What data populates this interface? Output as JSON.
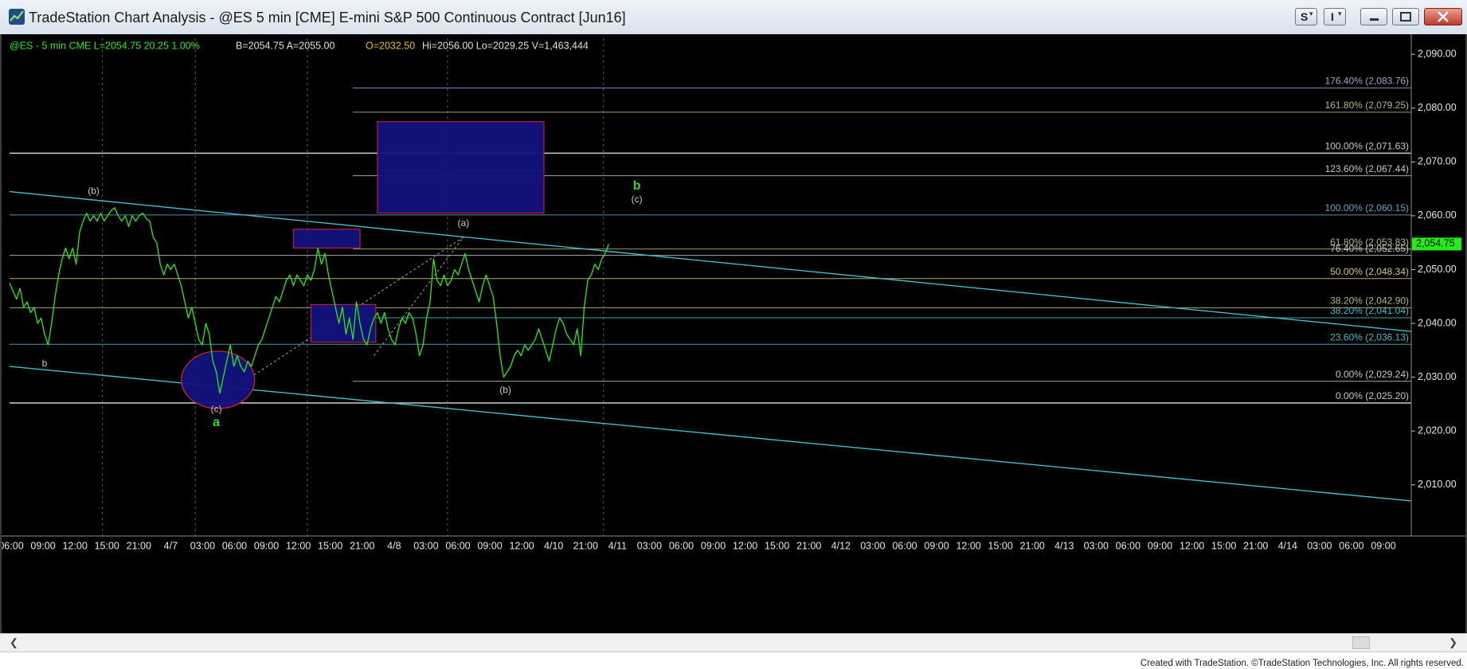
{
  "window": {
    "title": "TradeStation Chart Analysis - @ES 5 min [CME] E-mini S&P 500 Continuous Contract [Jun16]",
    "s_button_label": "S",
    "i_button_label": "I"
  },
  "header": {
    "symbol_line": "@ES - 5 min  CME  L=2054.75  20.25  1.00%",
    "bid_ask": "B=2054.75  A=2055.00",
    "open": "O=2032.50",
    "high_low_volume": "Hi=2056.00  Lo=2029.25  V=1,463,444"
  },
  "colors": {
    "background": "#000000",
    "price": "#22ee11",
    "channel": "#3ec0c8",
    "box_fill": "#12127e",
    "box_border": "#c8223a",
    "wave_green": "#33dd22",
    "label_gray": "#c8c8d0",
    "last_price_bg": "#22ee11"
  },
  "footer": {
    "credit": "Created with TradeStation. ©TradeStation Technologies, Inc. All rights reserved."
  },
  "chart_data": {
    "type": "line",
    "title": "",
    "xlabel": "",
    "ylabel": "",
    "ylim": [
      2003,
      2093
    ],
    "last_price": "2,054.75",
    "y_ticks": [
      2010,
      2020,
      2030,
      2040,
      2050,
      2060,
      2070,
      2080,
      2090
    ],
    "y_tick_labels": [
      "2,010.00",
      "2,020.00",
      "2,030.00",
      "2,040.00",
      "2,050.00",
      "2,060.00",
      "2,070.00",
      "2,080.00",
      "2,090.00"
    ],
    "x_tick_labels": [
      "06:00",
      "09:00",
      "12:00",
      "15:00",
      "21:00",
      "4/7",
      "03:00",
      "06:00",
      "09:00",
      "12:00",
      "15:00",
      "21:00",
      "4/8",
      "03:00",
      "06:00",
      "09:00",
      "12:00",
      "4/10",
      "21:00",
      "4/11",
      "03:00",
      "06:00",
      "09:00",
      "12:00",
      "15:00",
      "21:00",
      "4/12",
      "03:00",
      "06:00",
      "09:00",
      "12:00",
      "15:00",
      "21:00",
      "4/13",
      "03:00",
      "06:00",
      "09:00",
      "12:00",
      "15:00",
      "21:00",
      "4/14",
      "03:00",
      "06:00",
      "09:00"
    ],
    "series": [
      {
        "name": "@ES 5 min",
        "points": [
          [
            0,
            2047.5
          ],
          [
            2,
            2046
          ],
          [
            4,
            2044.5
          ],
          [
            6,
            2046.5
          ],
          [
            8,
            2043
          ],
          [
            10,
            2044
          ],
          [
            12,
            2042
          ],
          [
            14,
            2043
          ],
          [
            16,
            2040
          ],
          [
            18,
            2041
          ],
          [
            20,
            2038
          ],
          [
            22,
            2036
          ],
          [
            24,
            2040
          ],
          [
            26,
            2045
          ],
          [
            28,
            2049
          ],
          [
            30,
            2052
          ],
          [
            32,
            2054
          ],
          [
            34,
            2052
          ],
          [
            36,
            2054
          ],
          [
            38,
            2051
          ],
          [
            40,
            2057
          ],
          [
            42,
            2059
          ],
          [
            44,
            2060.5
          ],
          [
            46,
            2059
          ],
          [
            48,
            2060
          ],
          [
            50,
            2059
          ],
          [
            52,
            2060.5
          ],
          [
            54,
            2059
          ],
          [
            56,
            2060
          ],
          [
            58,
            2061
          ],
          [
            60,
            2061.5
          ],
          [
            62,
            2060
          ],
          [
            64,
            2059
          ],
          [
            66,
            2060
          ],
          [
            68,
            2058
          ],
          [
            70,
            2060
          ],
          [
            72,
            2059
          ],
          [
            74,
            2060
          ],
          [
            76,
            2060.5
          ],
          [
            78,
            2059.5
          ],
          [
            80,
            2059
          ],
          [
            82,
            2056
          ],
          [
            84,
            2055
          ],
          [
            86,
            2051
          ],
          [
            88,
            2049
          ],
          [
            90,
            2051
          ],
          [
            92,
            2050
          ],
          [
            94,
            2051
          ],
          [
            96,
            2049
          ],
          [
            98,
            2047
          ],
          [
            100,
            2044
          ],
          [
            102,
            2041
          ],
          [
            104,
            2043
          ],
          [
            106,
            2040
          ],
          [
            108,
            2037
          ],
          [
            110,
            2036
          ],
          [
            112,
            2040
          ],
          [
            114,
            2038
          ],
          [
            116,
            2033
          ],
          [
            118,
            2031
          ],
          [
            120,
            2027
          ],
          [
            122,
            2030
          ],
          [
            124,
            2033
          ],
          [
            126,
            2036
          ],
          [
            128,
            2032
          ],
          [
            130,
            2034
          ],
          [
            132,
            2032
          ],
          [
            134,
            2031
          ],
          [
            136,
            2033
          ],
          [
            138,
            2032
          ],
          [
            140,
            2034
          ],
          [
            142,
            2036
          ],
          [
            144,
            2037
          ],
          [
            146,
            2039
          ],
          [
            148,
            2041
          ],
          [
            150,
            2043
          ],
          [
            152,
            2045
          ],
          [
            154,
            2044
          ],
          [
            156,
            2046
          ],
          [
            158,
            2048
          ],
          [
            160,
            2049
          ],
          [
            162,
            2047
          ],
          [
            164,
            2049
          ],
          [
            166,
            2048
          ],
          [
            168,
            2047
          ],
          [
            170,
            2049
          ],
          [
            172,
            2048
          ],
          [
            174,
            2050
          ],
          [
            176,
            2054
          ],
          [
            178,
            2051
          ],
          [
            180,
            2053
          ],
          [
            182,
            2049
          ],
          [
            184,
            2046
          ],
          [
            186,
            2043
          ],
          [
            188,
            2040
          ],
          [
            190,
            2043
          ],
          [
            192,
            2038
          ],
          [
            194,
            2041
          ],
          [
            196,
            2037
          ],
          [
            198,
            2044
          ],
          [
            200,
            2040
          ],
          [
            202,
            2037
          ],
          [
            204,
            2036
          ],
          [
            206,
            2039
          ],
          [
            208,
            2041
          ],
          [
            210,
            2042
          ],
          [
            212,
            2040
          ],
          [
            214,
            2042
          ],
          [
            216,
            2039
          ],
          [
            218,
            2037
          ],
          [
            220,
            2036
          ],
          [
            222,
            2039
          ],
          [
            224,
            2041
          ],
          [
            226,
            2040
          ],
          [
            228,
            2042
          ],
          [
            230,
            2041
          ],
          [
            232,
            2038
          ],
          [
            234,
            2034
          ],
          [
            236,
            2036
          ],
          [
            238,
            2041
          ],
          [
            240,
            2044
          ],
          [
            242,
            2052
          ],
          [
            244,
            2048
          ],
          [
            246,
            2047
          ],
          [
            248,
            2049
          ],
          [
            250,
            2047
          ],
          [
            252,
            2048
          ],
          [
            254,
            2050
          ],
          [
            256,
            2049
          ],
          [
            258,
            2051
          ],
          [
            260,
            2053
          ],
          [
            262,
            2050
          ],
          [
            264,
            2048
          ],
          [
            266,
            2046
          ],
          [
            268,
            2044
          ],
          [
            270,
            2047
          ],
          [
            272,
            2049
          ],
          [
            274,
            2047
          ],
          [
            276,
            2045
          ],
          [
            278,
            2040
          ],
          [
            280,
            2034
          ],
          [
            282,
            2030
          ],
          [
            284,
            2031
          ],
          [
            286,
            2032
          ],
          [
            288,
            2034
          ],
          [
            290,
            2035
          ],
          [
            292,
            2034
          ],
          [
            294,
            2036
          ],
          [
            296,
            2035
          ],
          [
            298,
            2036
          ],
          [
            300,
            2037
          ],
          [
            302,
            2039
          ],
          [
            304,
            2037
          ],
          [
            306,
            2035
          ],
          [
            308,
            2033
          ],
          [
            310,
            2036
          ],
          [
            312,
            2039
          ],
          [
            314,
            2041
          ],
          [
            316,
            2040
          ],
          [
            318,
            2038
          ],
          [
            320,
            2037
          ],
          [
            322,
            2036
          ],
          [
            324,
            2039
          ],
          [
            326,
            2034
          ],
          [
            328,
            2043
          ],
          [
            330,
            2048
          ],
          [
            332,
            2049
          ],
          [
            334,
            2051
          ],
          [
            336,
            2050
          ],
          [
            338,
            2052
          ],
          [
            340,
            2053
          ],
          [
            342,
            2054.75
          ]
        ]
      }
    ],
    "channel_lines": [
      {
        "from": [
          0,
          2064.5
        ],
        "to": [
          800,
          2038.5
        ]
      },
      {
        "from": [
          0,
          2032
        ],
        "to": [
          800,
          2007
        ]
      }
    ],
    "boxes": [
      {
        "x0": 210,
        "x1": 305,
        "y0": 2060.5,
        "y1": 2077.5
      },
      {
        "x0": 162,
        "x1": 200,
        "y0": 2054,
        "y1": 2057.5
      },
      {
        "x0": 172,
        "x1": 209,
        "y0": 2036.5,
        "y1": 2043.5
      }
    ],
    "ellipse": {
      "cx": 119,
      "cy": 2029.5,
      "label": "(c)"
    },
    "dashed_lines": [
      {
        "from": [
          119,
          2026
        ],
        "to": [
          259,
          2056
        ]
      },
      {
        "from": [
          208,
          2034
        ],
        "to": [
          259,
          2056
        ]
      }
    ],
    "fib_levels": [
      {
        "label": "176.40% (2,083.76)",
        "value": 2083.76,
        "color": "#9aa8c8"
      },
      {
        "label": "161.80% (2,079.25)",
        "value": 2079.25,
        "color": "#b8b87a"
      },
      {
        "label": "100.00% (2,071.63)",
        "value": 2071.63,
        "color": "#c8c8c8"
      },
      {
        "label": "123.60% (2,067.44)",
        "value": 2067.44,
        "color": "#c8c8c8"
      },
      {
        "label": "100.00% (2,060.15)",
        "value": 2060.15,
        "color": "#6fa0c8"
      },
      {
        "label": "61.80% (2,053.83)",
        "value": 2053.83,
        "color": "#b8b87a"
      },
      {
        "label": "76.40% (2,052.65)",
        "value": 2052.65,
        "color": "#c8c8c8"
      },
      {
        "label": "50.00% (2,048.34)",
        "value": 2048.34,
        "color": "#d8c87a"
      },
      {
        "label": "38.20% (2,042.90)",
        "value": 2042.9,
        "color": "#b8b87a"
      },
      {
        "label": "38.20% (2,041.04)",
        "value": 2041.04,
        "color": "#3ec0c8"
      },
      {
        "label": "23.60% (2,036.13)",
        "value": 2036.13,
        "color": "#3ec0c8"
      },
      {
        "label": "0.00% (2,029.24)",
        "value": 2029.24,
        "color": "#c8c8c8"
      },
      {
        "label": "0.00% (2,025.20)",
        "value": 2025.2,
        "color": "#c8c8c8"
      }
    ],
    "wave_labels": [
      {
        "text": "b",
        "x": 20,
        "y": 2032.5,
        "style": "gray"
      },
      {
        "text": "(b)",
        "x": 48,
        "y": 2064.5,
        "style": "gray"
      },
      {
        "text": "(c)",
        "x": 118,
        "y": 2024,
        "style": "gray"
      },
      {
        "text": "a",
        "x": 118,
        "y": 2021.5,
        "style": "green"
      },
      {
        "text": "(a)",
        "x": 259,
        "y": 2058.5,
        "style": "gray"
      },
      {
        "text": "(b)",
        "x": 283,
        "y": 2027.5,
        "style": "gray"
      },
      {
        "text": "b",
        "x": 358,
        "y": 2065.5,
        "style": "green"
      },
      {
        "text": "(c)",
        "x": 358,
        "y": 2063,
        "style": "gray"
      }
    ],
    "grid": "vertical dashed session lines",
    "x_range": [
      0,
      800
    ]
  }
}
